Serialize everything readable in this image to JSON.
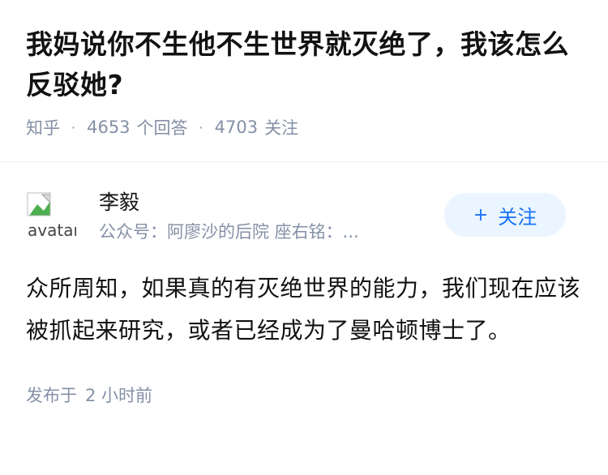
{
  "question": {
    "title": "我妈说你不生他不生世界就灭绝了，我该怎么反驳她?",
    "source": "知乎",
    "answers_count": "4653",
    "answers_label": "个回答",
    "followers_count": "4703",
    "followers_label": "关注"
  },
  "answer": {
    "author": {
      "avatar_alt": "avatar",
      "name": "李毅",
      "bio": "公众号：阿廖沙的后院 座右铭：...",
      "follow_label": "关注"
    },
    "content": "众所周知，如果真的有灭绝世界的能力，我们现在应该被抓起来研究，或者已经成为了曼哈顿博士了。",
    "published_label": "发布于",
    "published_time": "2 小时前"
  }
}
